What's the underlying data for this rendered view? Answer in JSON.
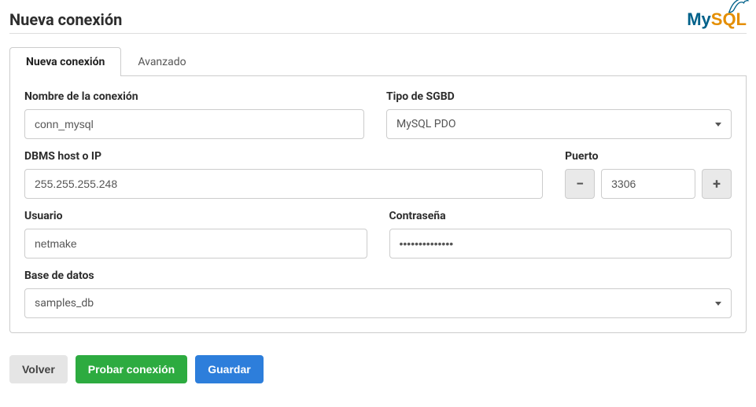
{
  "header": {
    "title": "Nueva conexión",
    "logo_my": "My",
    "logo_sql": "SQL"
  },
  "tabs": {
    "new": "Nueva conexión",
    "advanced": "Avanzado"
  },
  "fields": {
    "conn_name": {
      "label": "Nombre de la conexión",
      "value": "conn_mysql"
    },
    "dbms_type": {
      "label": "Tipo de SGBD",
      "value": "MySQL PDO"
    },
    "host": {
      "label": "DBMS host o IP",
      "value": "255.255.255.248"
    },
    "port": {
      "label": "Puerto",
      "value": "3306"
    },
    "user": {
      "label": "Usuario",
      "value": "netmake"
    },
    "password": {
      "label": "Contraseña",
      "value": "••••••••••••••"
    },
    "database": {
      "label": "Base de datos",
      "value": "samples_db"
    }
  },
  "buttons": {
    "back": "Volver",
    "test": "Probar conexión",
    "save": "Guardar",
    "minus": "−",
    "plus": "+"
  }
}
